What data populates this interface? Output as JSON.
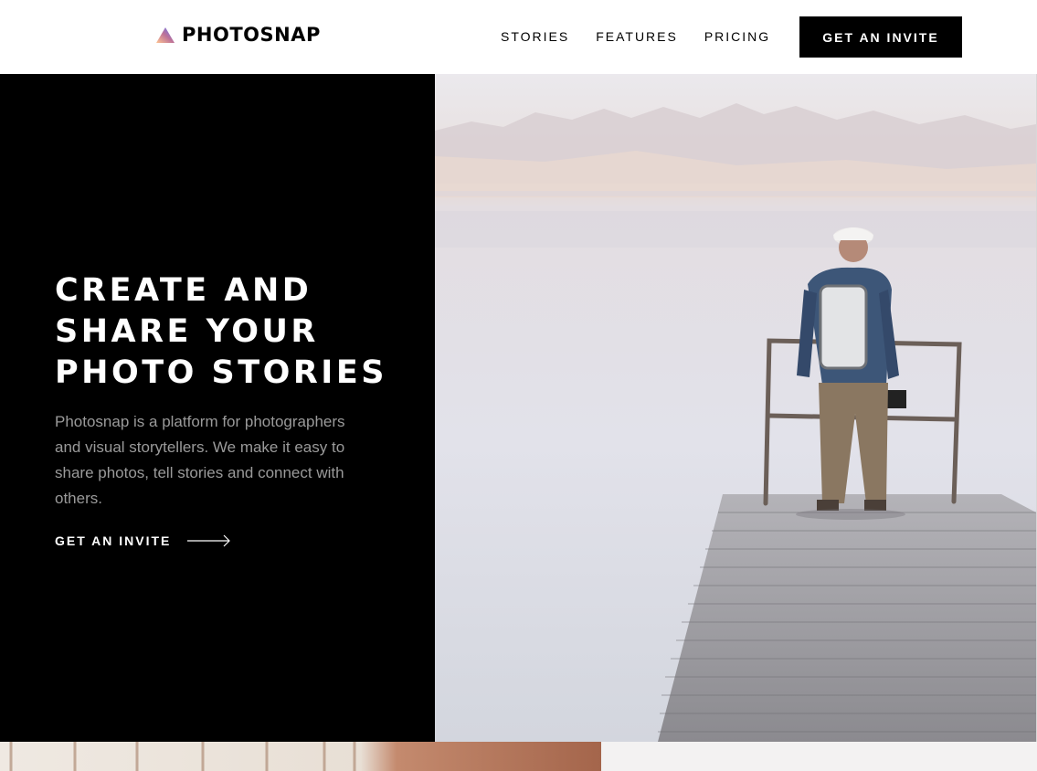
{
  "brand": {
    "name": "PHOTOSNAP",
    "icon": "triangle-logo-icon"
  },
  "nav": {
    "links": [
      {
        "label": "STORIES"
      },
      {
        "label": "FEATURES"
      },
      {
        "label": "PRICING"
      }
    ],
    "cta_label": "GET AN INVITE"
  },
  "hero": {
    "title_lines": [
      "CREATE AND",
      "SHARE YOUR",
      "PHOTO STORIES"
    ],
    "description": "Photosnap is a platform for photographers and visual storytellers. We make it easy to share photos, tell stories and connect with others.",
    "link_label": "GET AN INVITE",
    "link_icon": "arrow-right-icon",
    "image_subject": "man-on-pier-photo"
  },
  "colors": {
    "background": "#000000",
    "text_light": "#ffffff",
    "text_muted": "#9a9a9a",
    "logo_gradient": [
      "#ffc593",
      "#bc7198",
      "#5a77ff"
    ]
  }
}
